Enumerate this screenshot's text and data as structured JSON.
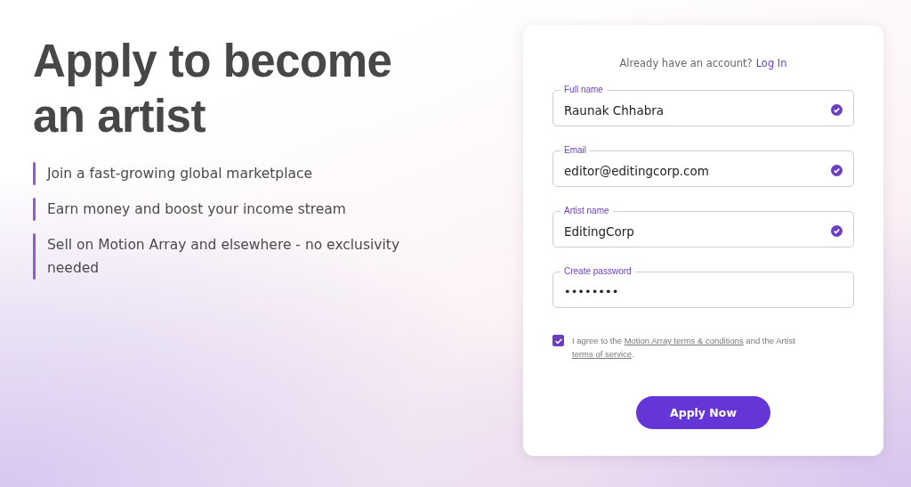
{
  "heading": "Apply to become an artist",
  "benefits": [
    "Join a fast-growing global marketplace",
    "Earn money and boost your income stream",
    "Sell on Motion Array and elsewhere - no exclusivity needed"
  ],
  "form": {
    "login_prompt": "Already have an account?",
    "login_link": "Log In",
    "fields": [
      {
        "label": "Full name",
        "value": "Raunak Chhabra",
        "valid": true
      },
      {
        "label": "Email",
        "value": "editor@editingcorp.com",
        "valid": true
      },
      {
        "label": "Artist name",
        "value": "EditingCorp",
        "valid": true
      },
      {
        "label": "Create password",
        "value": "••••••••",
        "valid": false
      }
    ],
    "agreement": {
      "checked": true,
      "parts": [
        {
          "kind": "text",
          "text": "I agree to the "
        },
        {
          "kind": "link",
          "text": "Motion Array terms & conditions"
        },
        {
          "kind": "text",
          "text": " and the Artist "
        },
        {
          "kind": "link",
          "text": "terms of service"
        },
        {
          "kind": "text",
          "text": "."
        }
      ]
    },
    "submit": "Apply Now"
  }
}
